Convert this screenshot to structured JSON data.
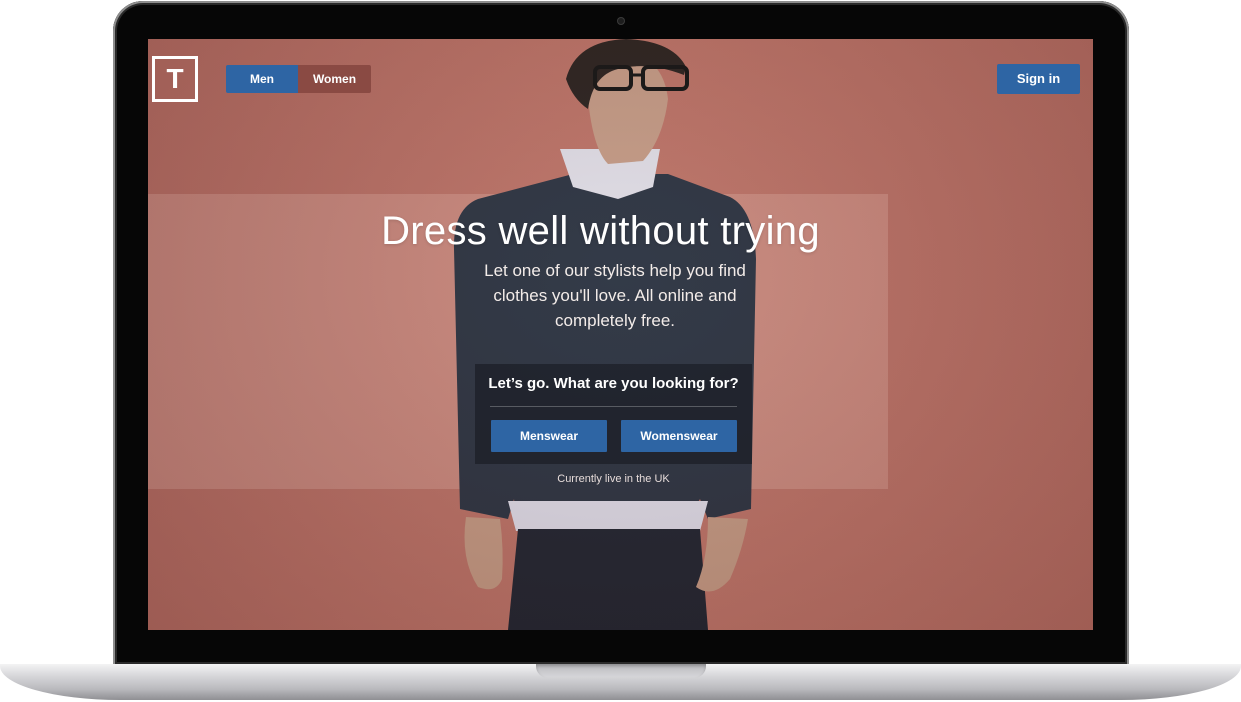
{
  "header": {
    "logo_text": "T",
    "gender_tabs": [
      {
        "label": "Men",
        "active": true
      },
      {
        "label": "Women",
        "active": false
      }
    ],
    "signin_label": "Sign in"
  },
  "hero": {
    "title": "Dress well without trying",
    "subtitle": "Let one of our stylists help you find clothes you'll love. All online and completely free."
  },
  "cta": {
    "question": "Let’s go. What are you looking for?",
    "buttons": [
      {
        "label": "Menswear"
      },
      {
        "label": "Womenswear"
      }
    ],
    "note": "Currently live in the UK"
  },
  "colors": {
    "accent": "#2e65a4",
    "wall": "#b8705f",
    "women_tab": "#8a4a43",
    "panel": "#14161e"
  },
  "icons": {
    "logo": "t-square-logo"
  }
}
